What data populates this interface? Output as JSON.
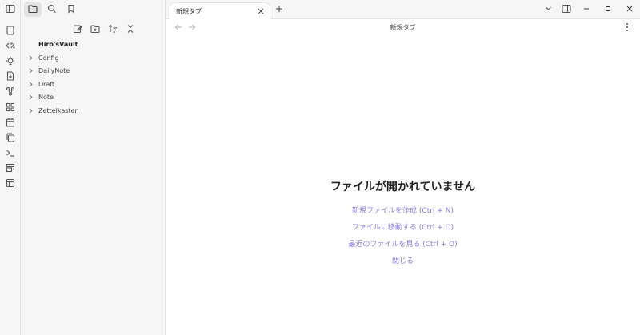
{
  "sidebar": {
    "vault_name": "Hiro'sVault",
    "tree": [
      "Config",
      "DailyNote",
      "Draft",
      "Note",
      "Zettelkasten"
    ]
  },
  "tabs": [
    {
      "label": "新規タブ"
    }
  ],
  "view": {
    "title": "新規タブ"
  },
  "empty_state": {
    "title": "ファイルが開かれていません",
    "actions": [
      "新規ファイルを作成 (Ctrl + N)",
      "ファイルに移動する (Ctrl + O)",
      "最近のファイルを見る (Ctrl + O)",
      "閉じる"
    ]
  },
  "colors": {
    "accent": "#8a7ce0",
    "sidebar_bg": "#f6f6f6",
    "border": "#e3e3e3"
  },
  "icons": {
    "ribbon": [
      "sidebar-toggle-icon",
      "note-icon",
      "code-icon",
      "bulb-icon",
      "file-plus-icon",
      "graph-icon",
      "grid-icon",
      "calendar-icon",
      "copy-icon",
      "terminal-icon",
      "template-icon",
      "layout-icon"
    ],
    "sidebar_tabs": [
      "folder-icon",
      "search-icon",
      "bookmark-icon"
    ],
    "sidebar_actions": [
      "new-note-icon",
      "new-folder-icon",
      "sort-icon",
      "collapse-icon"
    ]
  }
}
